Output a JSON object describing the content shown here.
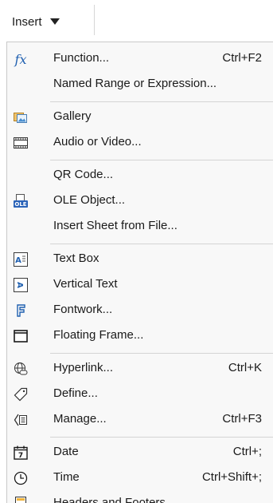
{
  "menubar": {
    "insert_label": "Insert"
  },
  "menu": {
    "function": {
      "label": "Function...",
      "shortcut": "Ctrl+F2",
      "icon": "fx-icon"
    },
    "named_range": {
      "label": "Named Range or Expression..."
    },
    "gallery": {
      "label": "Gallery",
      "icon": "gallery-icon"
    },
    "audio_video": {
      "label": "Audio or Video...",
      "icon": "film-icon"
    },
    "qr_code": {
      "label": "QR Code..."
    },
    "ole_object": {
      "label": "OLE Object...",
      "icon": "ole-icon"
    },
    "insert_sheet": {
      "label": "Insert Sheet from File..."
    },
    "text_box": {
      "label": "Text Box",
      "icon": "text-box-icon"
    },
    "vertical_text": {
      "label": "Vertical Text",
      "icon": "vertical-text-icon"
    },
    "fontwork": {
      "label": "Fontwork...",
      "icon": "fontwork-icon"
    },
    "floating_frame": {
      "label": "Floating Frame...",
      "icon": "frame-icon"
    },
    "hyperlink": {
      "label": "Hyperlink...",
      "shortcut": "Ctrl+K",
      "icon": "globe-link-icon"
    },
    "define": {
      "label": "Define...",
      "icon": "tag-icon"
    },
    "manage": {
      "label": "Manage...",
      "shortcut": "Ctrl+F3",
      "icon": "manage-icon"
    },
    "date": {
      "label": "Date",
      "shortcut": "Ctrl+;",
      "icon": "calendar-icon"
    },
    "time": {
      "label": "Time",
      "shortcut": "Ctrl+Shift+;",
      "icon": "clock-icon"
    },
    "headers_footers": {
      "label": "Headers and Footers...",
      "icon": "header-footer-icon"
    }
  },
  "colors": {
    "accent": "#2060b0",
    "menu_bg": "#f8f8f8",
    "separator": "#d4d4d4"
  }
}
